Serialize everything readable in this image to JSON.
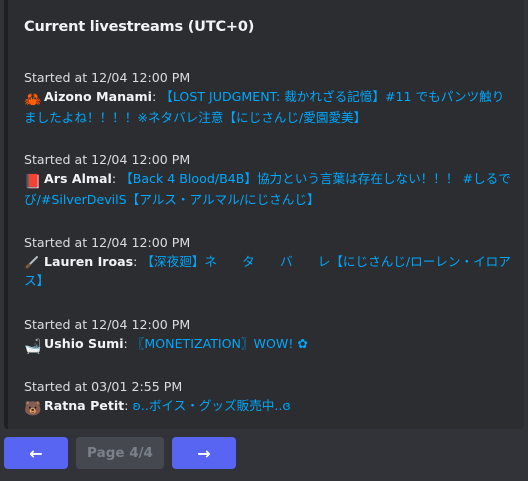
{
  "embed": {
    "title": "Current livestreams (UTC+0)",
    "accent_color": "#1e1f22"
  },
  "entries": [
    {
      "started": "Started at 12/04 12:00 PM",
      "emoji": "🦀",
      "emoji_name": "crab-icon",
      "name": "Aizono Manami",
      "colon": ":",
      "link_text": "【LOST JUDGMENT: 裁かれざる記憶】#11 でもパンツ触りましたよね！！！！※ネタバレ注意【にじさんじ/愛園愛美】"
    },
    {
      "started": "Started at 12/04 12:00 PM",
      "emoji": "📕",
      "emoji_name": "red-book-icon",
      "name": "Ars Almal",
      "colon": ":",
      "link_text": "【Back 4 Blood/B4B】協力という言葉は存在しない！！！ #しるでび/#SilverDevilS【アルス・アルマル/にじさんじ】"
    },
    {
      "started": "Started at 12/04 12:00 PM",
      "emoji": "🗡",
      "emoji_name": "dagger-icon",
      "name": "Lauren Iroas",
      "colon": ":",
      "link_text": "【深夜廻】ネ　　タ　　バ　　レ【にじさんじ/ローレン・イロアス】"
    },
    {
      "started": "Started at 12/04 12:00 PM",
      "emoji": "🛁",
      "emoji_name": "bathtub-icon",
      "name": "Ushio Sumi",
      "colon": ":",
      "link_text": "〖MONETIZATION〗WOW! ✿"
    },
    {
      "started": "Started at 03/01 2:55 PM",
      "emoji": "🐻",
      "emoji_name": "bear-icon",
      "name": "Ratna Petit",
      "colon": ":",
      "link_text": "ʚ..ボイス・グッズ販売中..ɞ"
    }
  ],
  "pagination": {
    "prev_label": "←",
    "page_label": "Page 4/4",
    "next_label": "→"
  },
  "colors": {
    "background": "#313338",
    "embed_bg": "#2b2d31",
    "link": "#00a8fc",
    "button": "#5865f2"
  }
}
